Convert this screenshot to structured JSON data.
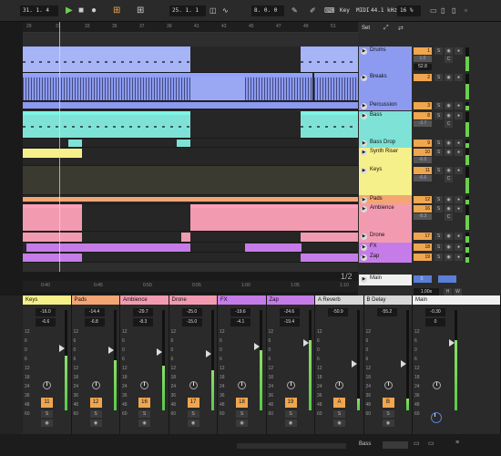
{
  "transport": {
    "position_bar": "31",
    "position_beat": "1",
    "position_sixteenth": "4",
    "play_glyph": "▶",
    "stop_glyph": "■",
    "record_glyph": "●",
    "loop_glyph": "⊞",
    "loop_start_bar": "25",
    "loop_start_beat": "1",
    "loop_start_sixteenth": "1",
    "loop_length_bar": "8",
    "loop_length_beat": "0",
    "loop_length_sixteenth": "0",
    "key_label": "Key",
    "midi_label": "MIDI",
    "sample_rate": "44.1 kHz",
    "cpu_load": "16 %"
  },
  "ruler": {
    "bar_numbers": [
      "29",
      "31",
      "33",
      "35",
      "37",
      "39",
      "41",
      "43",
      "45",
      "47",
      "49",
      "51"
    ]
  },
  "timeline": {
    "times": [
      "0:40",
      "0:45",
      "0:50",
      "0:55",
      "1:00",
      "1:05",
      "1:10"
    ],
    "page_indicator": "1/2"
  },
  "set_label": "Set",
  "tracks": [
    {
      "number": "1",
      "name": "Drums",
      "color": "#8c9bf0",
      "volume": "1.0",
      "pan": "C",
      "extra": "52.8"
    },
    {
      "number": "2",
      "name": "Breaks",
      "color": "#8c9bf0",
      "volume": "",
      "pan": "",
      "extra": ""
    },
    {
      "number": "3",
      "name": "Percussion",
      "color": "#8c9bf0",
      "volume": "",
      "pan": "",
      "extra": ""
    },
    {
      "number": "8",
      "name": "Bass",
      "color": "#7fe2d7",
      "volume": "-3.7",
      "pan": "C",
      "extra": ""
    },
    {
      "number": "9",
      "name": "Bass Drop",
      "color": "#7fe2d7",
      "volume": "",
      "pan": "",
      "extra": ""
    },
    {
      "number": "10",
      "name": "Synth Riser",
      "color": "#f6f08a",
      "volume": "-6.0",
      "pan": "",
      "extra": ""
    },
    {
      "number": "11",
      "name": "Keys",
      "color": "#f6f08a",
      "volume": "-6.6",
      "pan": "C",
      "extra": ""
    },
    {
      "number": "12",
      "name": "Pads",
      "color": "#f3a674",
      "volume": "",
      "pan": "",
      "extra": ""
    },
    {
      "number": "16",
      "name": "Ambience",
      "color": "#f29bb0",
      "volume": "-8.3",
      "pan": "C",
      "extra": ""
    },
    {
      "number": "17",
      "name": "Drone",
      "color": "#f29bb0",
      "volume": "",
      "pan": "",
      "extra": ""
    },
    {
      "number": "18",
      "name": "FX",
      "color": "#c67ce8",
      "volume": "",
      "pan": "",
      "extra": ""
    },
    {
      "number": "19",
      "name": "Zap",
      "color": "#c67ce8",
      "volume": "",
      "pan": "",
      "extra": ""
    }
  ],
  "main_track": {
    "name": "Main",
    "tempo_scale": "1.00x",
    "h": "H",
    "w": "W",
    "value": "0"
  },
  "track_buttons": {
    "solo": "S",
    "monitor": "◉",
    "arm": "●"
  },
  "mixer": {
    "channels": [
      {
        "name": "Keys",
        "number": "11",
        "volume": "-16.0",
        "peak": "-6.6",
        "color": "#f6f08a",
        "level": 0.55
      },
      {
        "name": "Pads",
        "number": "12",
        "volume": "-14.4",
        "peak": "-6.8",
        "color": "#f3a674",
        "level": 0.5
      },
      {
        "name": "Ambience",
        "number": "16",
        "volume": "-29.7",
        "peak": "-8.3",
        "color": "#f29bb0",
        "level": 0.45
      },
      {
        "name": "Drone",
        "number": "17",
        "volume": "-25.0",
        "peak": "-15.0",
        "color": "#f29bb0",
        "level": 0.4
      },
      {
        "name": "FX",
        "number": "18",
        "volume": "-19.6",
        "peak": "-4.1",
        "color": "#c67ce8",
        "level": 0.6
      },
      {
        "name": "Zap",
        "number": "19",
        "volume": "-24.6",
        "peak": "-19.4",
        "color": "#c67ce8",
        "level": 0.7
      },
      {
        "name": "A Reverb",
        "number": "A",
        "volume": "-50.9",
        "peak": "",
        "color": "#d8d8d8",
        "level": 0.12
      },
      {
        "name": "B Delay",
        "number": "B",
        "volume": "-55.2",
        "peak": "",
        "color": "#d8d8d8",
        "level": 0.12
      },
      {
        "name": "Main",
        "number": "",
        "volume": "-0.30",
        "peak": "0",
        "color": "#f0f0f0",
        "level": 0.7
      }
    ],
    "scale": [
      "12",
      "6",
      "0",
      "6",
      "12",
      "18",
      "24",
      "36",
      "48",
      "60"
    ]
  },
  "bottom_bar": {
    "track_label": "Bass"
  }
}
